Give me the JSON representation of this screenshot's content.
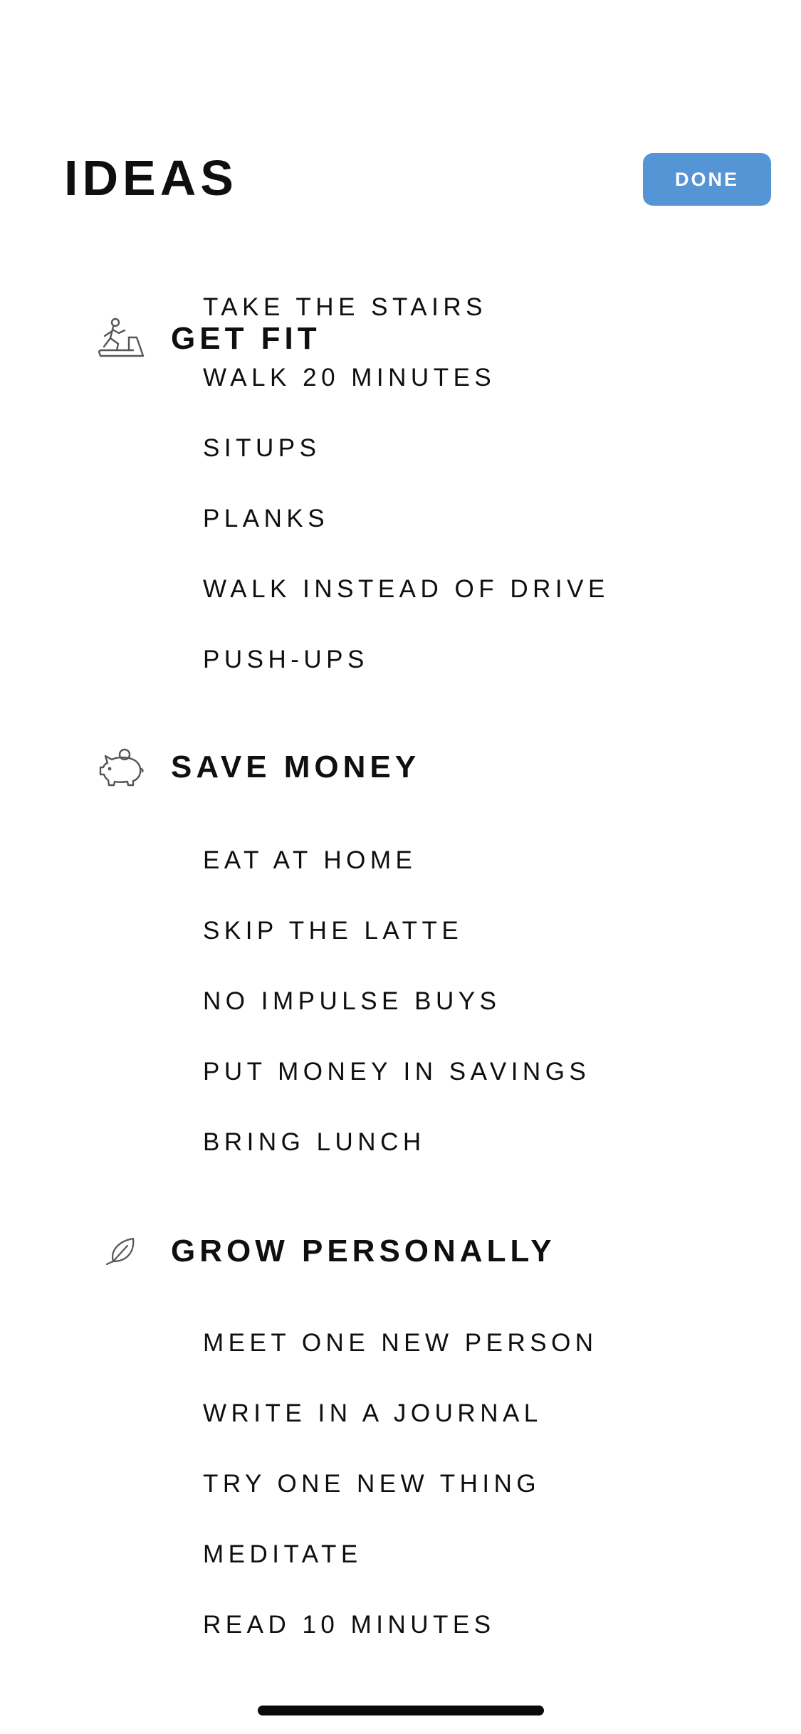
{
  "header": {
    "title": "IDEAS",
    "done_label": "DONE"
  },
  "colors": {
    "accent": "#5595d6",
    "text": "#0f0f0f",
    "icon_stroke": "#555555",
    "background": "#ffffff"
  },
  "sections": [
    {
      "title": "GET FIT",
      "icon": "treadmill-icon",
      "items": [
        "TAKE THE STAIRS",
        "WALK 20 MINUTES",
        "SITUPS",
        "PLANKS",
        "WALK INSTEAD OF DRIVE",
        "PUSH-UPS"
      ]
    },
    {
      "title": "SAVE MONEY",
      "icon": "piggy-bank-icon",
      "items": [
        "EAT AT HOME",
        "SKIP THE LATTE",
        "NO IMPULSE BUYS",
        "PUT MONEY IN SAVINGS",
        "BRING LUNCH"
      ]
    },
    {
      "title": "GROW PERSONALLY",
      "icon": "leaf-icon",
      "items": [
        "MEET ONE NEW PERSON",
        "WRITE IN A JOURNAL",
        "TRY ONE NEW THING",
        "MEDITATE",
        "READ 10 MINUTES"
      ]
    }
  ]
}
